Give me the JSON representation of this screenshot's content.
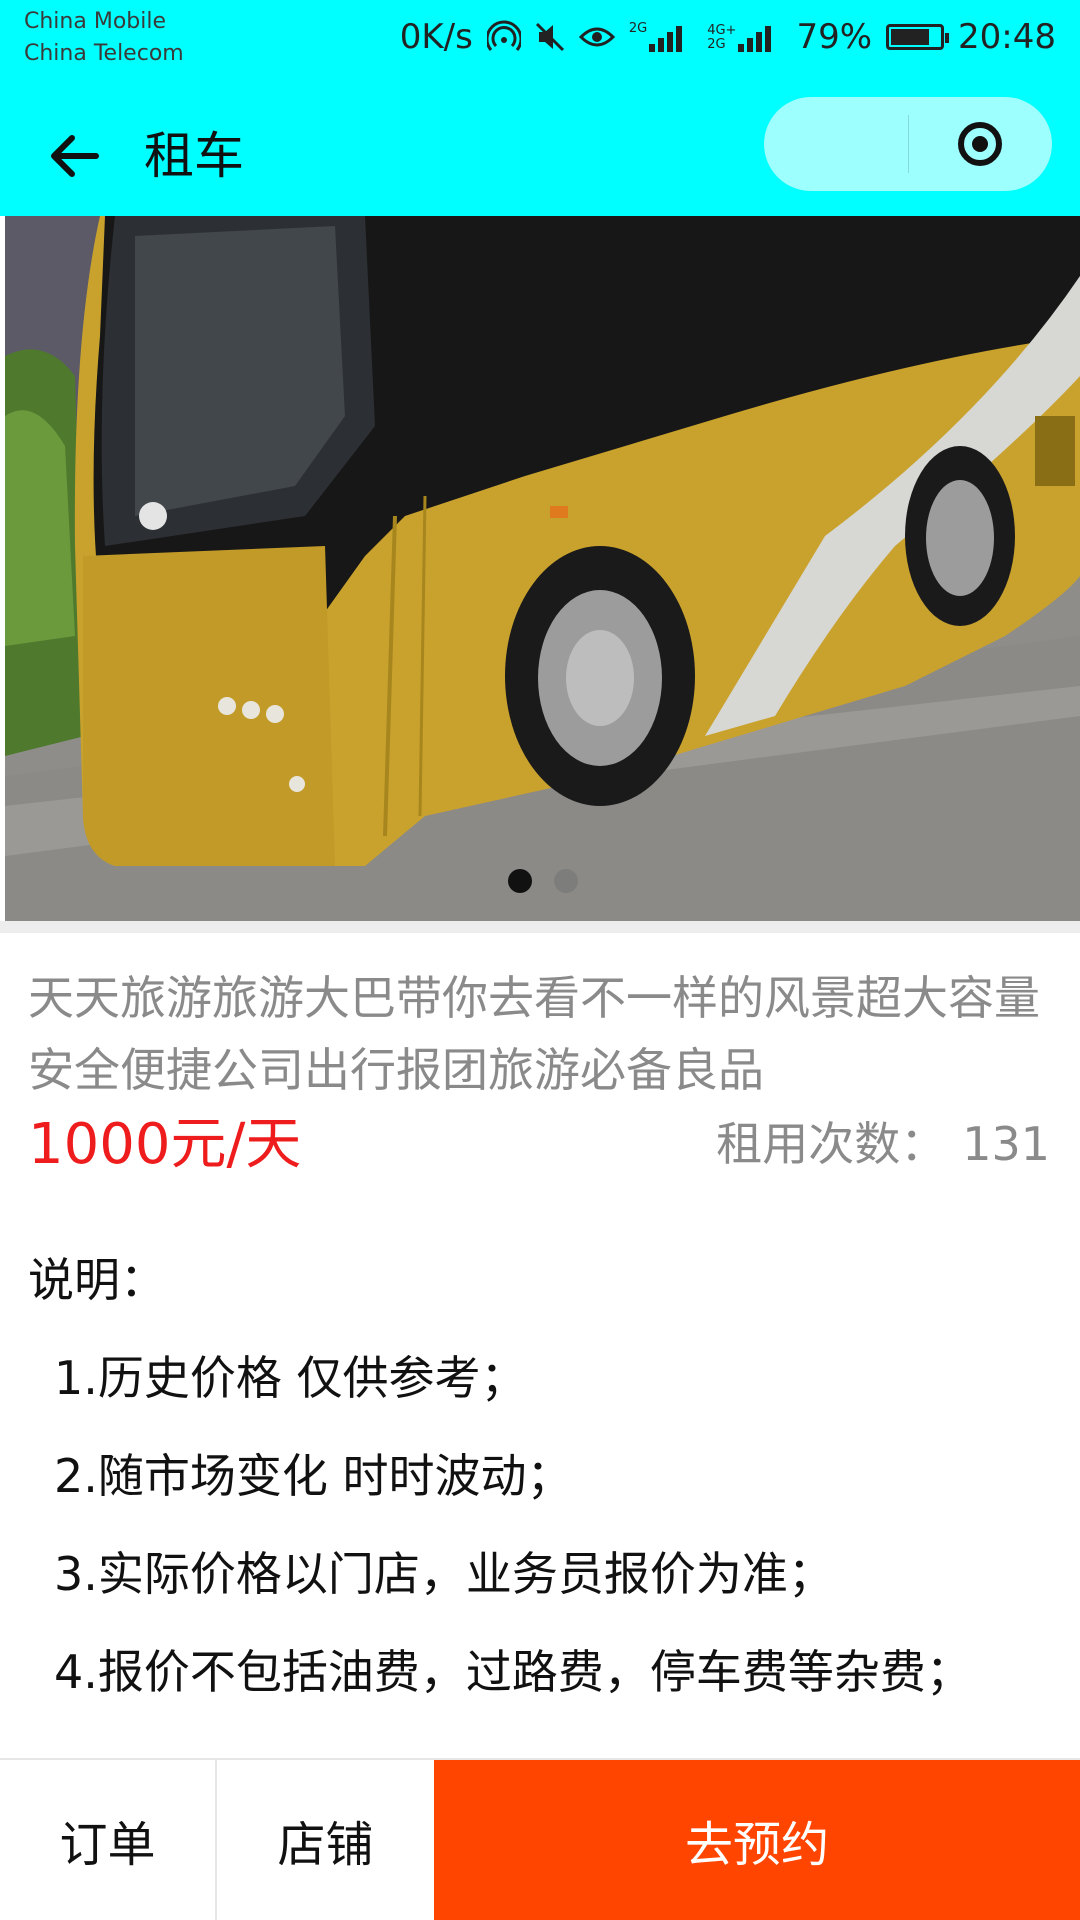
{
  "status_bar": {
    "carrier_1": "China Mobile",
    "carrier_2": "China Telecom",
    "net_speed": "0K/s",
    "network_1": "2G",
    "network_2": "4G+",
    "network_3": "2G",
    "battery": "79%",
    "battery_level": 0.79,
    "time": "20:48"
  },
  "nav": {
    "title": "租车",
    "back_icon": "arrow-left-icon",
    "more_icon": "more-dots-icon",
    "close_icon": "target-circle-icon"
  },
  "banner": {
    "slide_count": 2,
    "active_slide": 1
  },
  "product": {
    "title": "天天旅游旅游大巴带你去看不一样的风景超大容量安全便捷公司出行报团旅游必备良品",
    "price": "1000元/天",
    "rent_count_label": "租用次数：",
    "rent_count": "131"
  },
  "description": {
    "label": "说明：",
    "items": [
      "1.历史价格 仅供参考；",
      "2.随市场变化 时时波动；",
      "3.实际价格以门店，业务员报价为准；",
      "4.报价不包括油费，过路费，停车费等杂费；"
    ]
  },
  "bottom_bar": {
    "orders_label": "订单",
    "store_label": "店铺",
    "book_label": "去预约"
  },
  "colors": {
    "header_bg": "#00FFFF",
    "price": "#EE1C1C",
    "book_button": "#FF4500",
    "muted_text": "#8A8A8A"
  }
}
